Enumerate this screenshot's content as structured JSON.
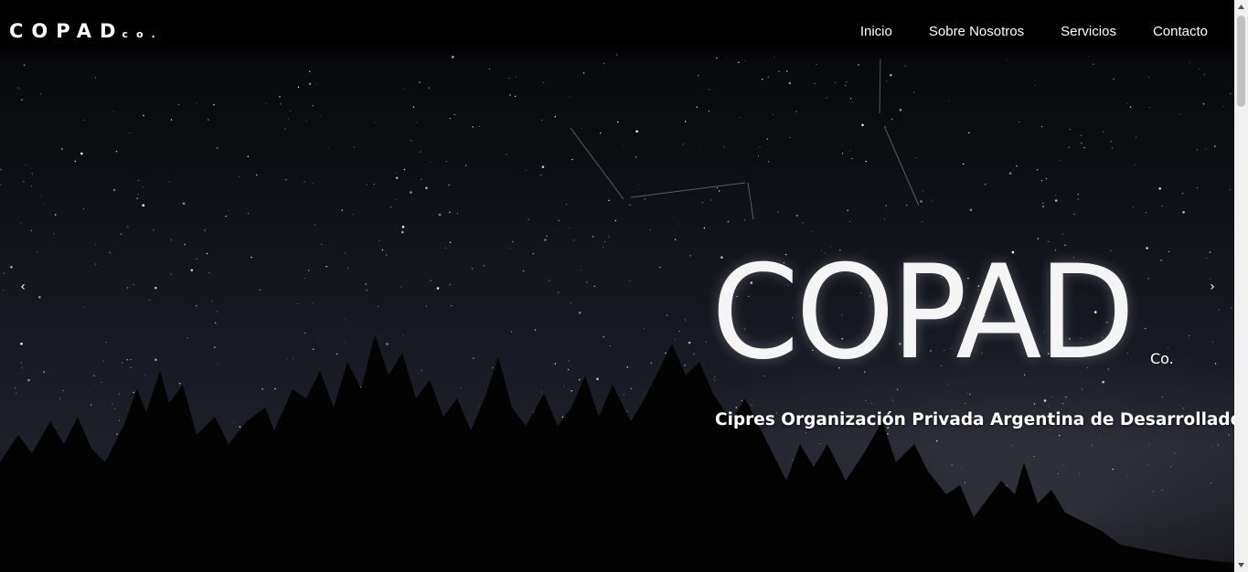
{
  "brand": {
    "main": "COPAD",
    "sub": "co."
  },
  "nav": {
    "items": [
      {
        "label": "Inicio"
      },
      {
        "label": "Sobre Nosotros"
      },
      {
        "label": "Servicios"
      },
      {
        "label": "Contacto"
      }
    ]
  },
  "hero": {
    "title": "COPAD",
    "title_suffix": "Co.",
    "subtitle": "Cipres Organización Privada Argentina de Desarrolladores.",
    "prev_icon": "chevron-left-icon",
    "next_icon": "chevron-right-icon",
    "prev_glyph": "‹",
    "next_glyph": "›"
  },
  "colors": {
    "text": "#ffffff",
    "background": "#000000"
  }
}
